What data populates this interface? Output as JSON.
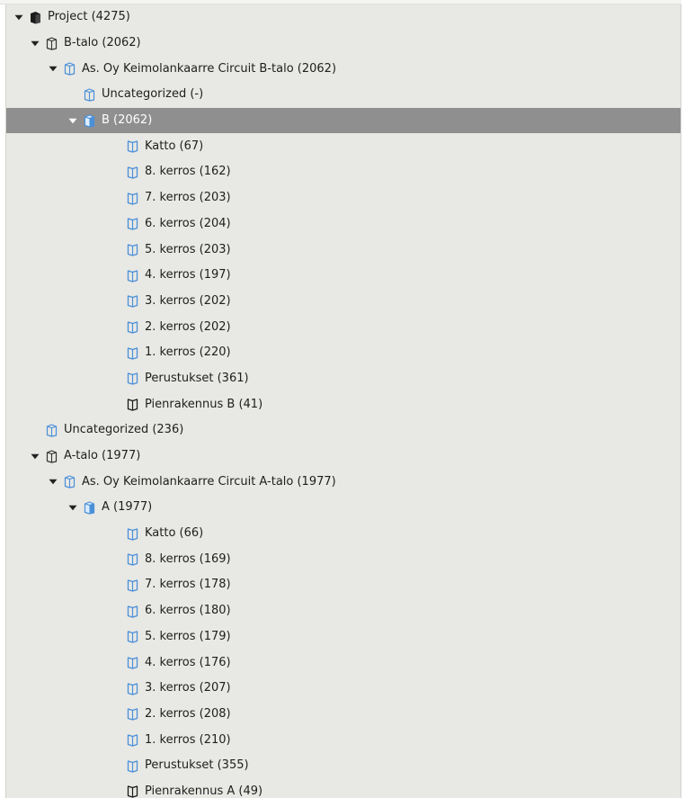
{
  "tree": {
    "colors": {
      "background": "#e8e8e4",
      "selected_background": "#8f8f8f",
      "icon_blue": "#4a90d9",
      "icon_dark": "#1a1a1a",
      "text": "#1e1e1e"
    },
    "rows": [
      {
        "label": "Project (4275)",
        "level": 0,
        "toggle": "expanded",
        "icon": "project-cube-solid-icon"
      },
      {
        "label": "B-talo (2062)",
        "level": 1,
        "toggle": "expanded",
        "icon": "building-outline-icon"
      },
      {
        "label": "As. Oy Keimolankaarre Circuit B-talo (2062)",
        "level": 2,
        "toggle": "expanded",
        "icon": "building-blue-icon"
      },
      {
        "label": "Uncategorized (-)",
        "level": 3,
        "toggle": "none",
        "icon": "building-blue-icon"
      },
      {
        "label": "B (2062)",
        "level": 3,
        "toggle": "expanded",
        "icon": "building-filled-blue-icon",
        "selected": true
      },
      {
        "label": "Katto (67)",
        "level": 4,
        "toggle": "none",
        "icon": "storey-blue-icon"
      },
      {
        "label": "8. kerros (162)",
        "level": 4,
        "toggle": "none",
        "icon": "storey-blue-icon"
      },
      {
        "label": "7. kerros (203)",
        "level": 4,
        "toggle": "none",
        "icon": "storey-blue-icon"
      },
      {
        "label": "6. kerros (204)",
        "level": 4,
        "toggle": "none",
        "icon": "storey-blue-icon"
      },
      {
        "label": "5. kerros (203)",
        "level": 4,
        "toggle": "none",
        "icon": "storey-blue-icon"
      },
      {
        "label": "4. kerros (197)",
        "level": 4,
        "toggle": "none",
        "icon": "storey-blue-icon"
      },
      {
        "label": "3. kerros (202)",
        "level": 4,
        "toggle": "none",
        "icon": "storey-blue-icon"
      },
      {
        "label": "2. kerros (202)",
        "level": 4,
        "toggle": "none",
        "icon": "storey-blue-icon"
      },
      {
        "label": "1. kerros (220)",
        "level": 4,
        "toggle": "none",
        "icon": "storey-blue-icon"
      },
      {
        "label": "Perustukset (361)",
        "level": 4,
        "toggle": "none",
        "icon": "storey-blue-icon"
      },
      {
        "label": "Pienrakennus B (41)",
        "level": 4,
        "toggle": "none",
        "icon": "storey-dark-icon"
      },
      {
        "label": "Uncategorized (236)",
        "level": 1,
        "toggle": "none",
        "icon": "building-blue-icon"
      },
      {
        "label": "A-talo (1977)",
        "level": 1,
        "toggle": "expanded",
        "icon": "building-outline-icon"
      },
      {
        "label": "As. Oy Keimolankaarre Circuit A-talo (1977)",
        "level": 2,
        "toggle": "expanded",
        "icon": "building-blue-icon"
      },
      {
        "label": "A (1977)",
        "level": 3,
        "toggle": "expanded",
        "icon": "building-filled-blue-icon"
      },
      {
        "label": "Katto (66)",
        "level": 4,
        "toggle": "none",
        "icon": "storey-blue-icon"
      },
      {
        "label": "8. kerros (169)",
        "level": 4,
        "toggle": "none",
        "icon": "storey-blue-icon"
      },
      {
        "label": "7. kerros (178)",
        "level": 4,
        "toggle": "none",
        "icon": "storey-blue-icon"
      },
      {
        "label": "6. kerros (180)",
        "level": 4,
        "toggle": "none",
        "icon": "storey-blue-icon"
      },
      {
        "label": "5. kerros (179)",
        "level": 4,
        "toggle": "none",
        "icon": "storey-blue-icon"
      },
      {
        "label": "4. kerros (176)",
        "level": 4,
        "toggle": "none",
        "icon": "storey-blue-icon"
      },
      {
        "label": "3. kerros (207)",
        "level": 4,
        "toggle": "none",
        "icon": "storey-blue-icon"
      },
      {
        "label": "2. kerros (208)",
        "level": 4,
        "toggle": "none",
        "icon": "storey-blue-icon"
      },
      {
        "label": "1. kerros (210)",
        "level": 4,
        "toggle": "none",
        "icon": "storey-blue-icon"
      },
      {
        "label": "Perustukset (355)",
        "level": 4,
        "toggle": "none",
        "icon": "storey-blue-icon"
      },
      {
        "label": "Pienrakennus A (49)",
        "level": 4,
        "toggle": "none",
        "icon": "storey-dark-icon"
      }
    ]
  }
}
